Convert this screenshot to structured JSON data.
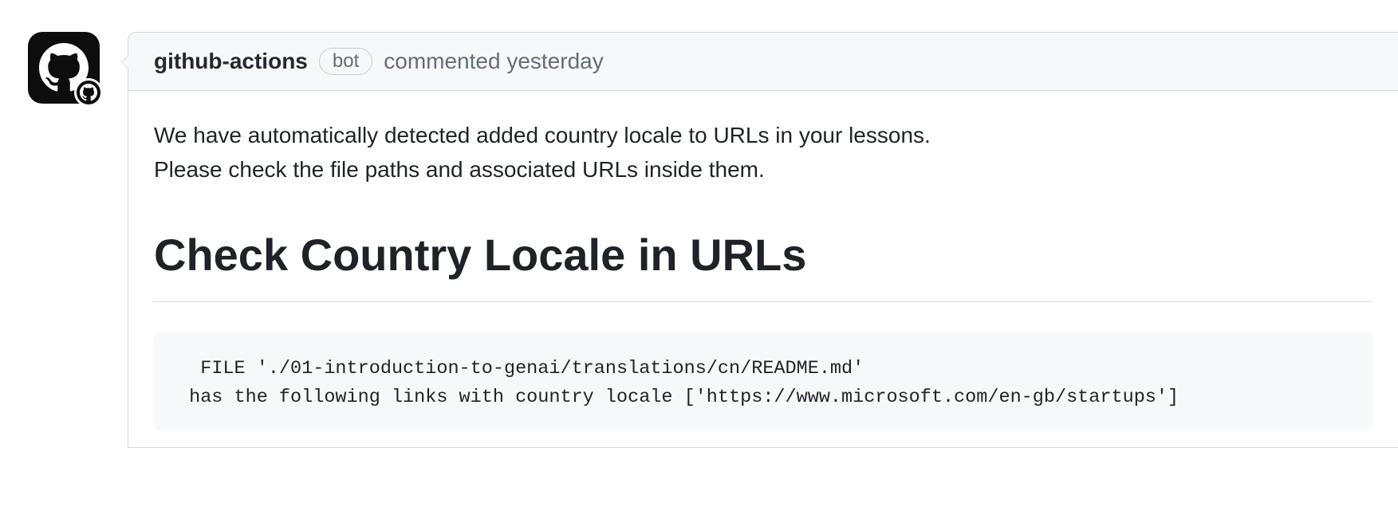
{
  "comment": {
    "author": "github-actions",
    "badge": "bot",
    "action_prefix": "commented ",
    "timestamp": "yesterday",
    "body": {
      "line1": "We have automatically detected added country locale to URLs in your lessons.",
      "line2": "Please check the file paths and associated URLs inside them.",
      "heading": "Check Country Locale in URLs",
      "code": "  FILE './01-introduction-to-genai/translations/cn/README.md'\n has the following links with country locale ['https://www.microsoft.com/en-gb/startups']"
    }
  }
}
